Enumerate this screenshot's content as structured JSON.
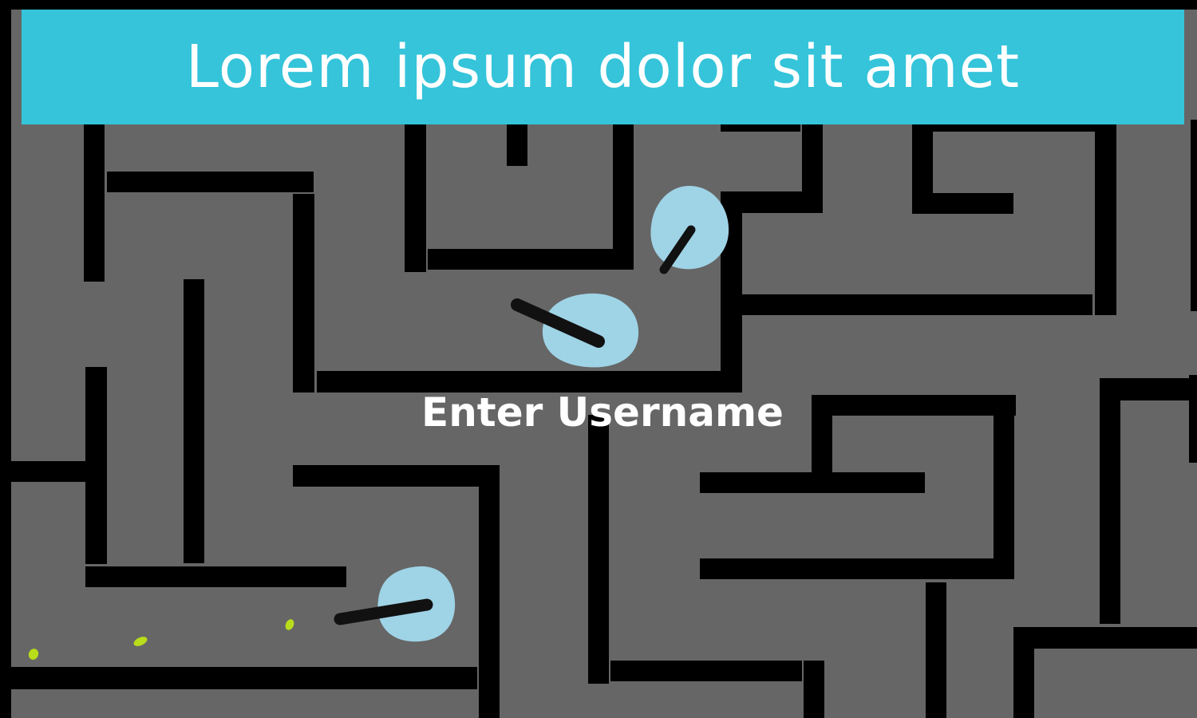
{
  "title": "Lorem ipsum dolor sit amet",
  "prompt": "Enter Username",
  "colors": {
    "floor": "#666666",
    "wall": "#000000",
    "banner": "#35c4da",
    "title_text": "#ffffff",
    "prompt_text": "#ffffff",
    "enemy_body": "#9fd3e6",
    "enemy_gun": "#111111",
    "bullet": "#b8dd1a"
  }
}
